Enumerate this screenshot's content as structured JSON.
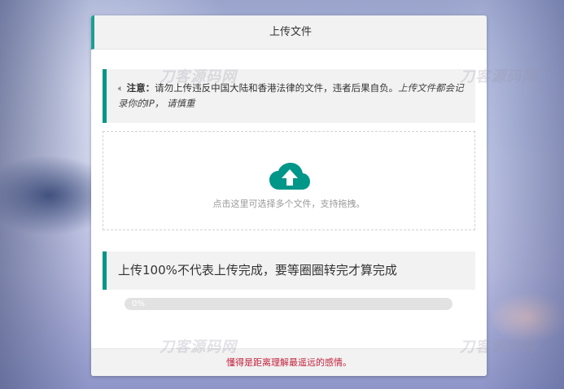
{
  "card": {
    "title": "上传文件"
  },
  "notice": {
    "label": "注意：",
    "text": "请勿上传违反中国大陆和香港法律的文件，违者后果自负。",
    "italic": "上传文件都会记录你的IP， 请慎重"
  },
  "dropzone": {
    "icon": "upload-cloud-icon",
    "hint": "点击这里可选择多个文件，支持拖拽。"
  },
  "quote": {
    "text": "上传100%不代表上传完成，要等圈圈转完才算完成"
  },
  "progress": {
    "value": 0,
    "label": "0%"
  },
  "footer": {
    "text": "懂得是距离理解最遥远的感情。"
  },
  "watermark": {
    "text": "刀客源码网"
  },
  "colors": {
    "accent": "#009688",
    "footer_text": "#c21f3a",
    "panel_bg": "#f2f2f2"
  }
}
